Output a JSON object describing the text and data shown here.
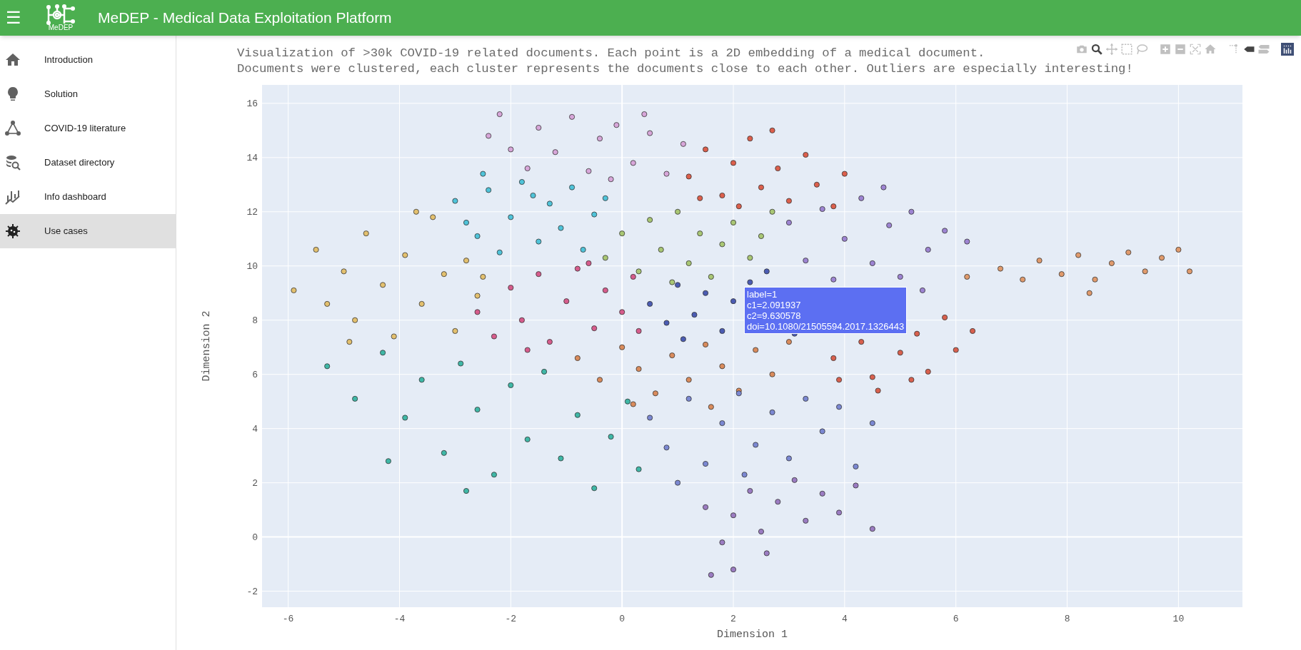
{
  "header": {
    "menu_icon": "☰",
    "logo_text": "MeDEP",
    "title": "MeDEP - Medical Data Exploitation Platform"
  },
  "sidebar": {
    "items": [
      {
        "kind": "home",
        "label": "Introduction",
        "selected": false
      },
      {
        "kind": "bulb",
        "label": "Solution",
        "selected": false
      },
      {
        "kind": "network",
        "label": "COVID-19 literature",
        "selected": false
      },
      {
        "kind": "database",
        "label": "Dataset directory",
        "selected": false
      },
      {
        "kind": "chart",
        "label": "Info dashboard",
        "selected": false
      },
      {
        "kind": "virus",
        "label": "Use cases",
        "selected": true
      }
    ]
  },
  "plot": {
    "title_lines": [
      "Visualization of >30k COVID-19 related documents. Each point is a 2D embedding of a medical document.",
      "Documents were clustered, each cluster represents the documents close to each other. Outliers are especially interesting!"
    ],
    "modebar": [
      {
        "kind": "camera",
        "selected": false
      },
      {
        "kind": "zoom",
        "selected": true
      },
      {
        "kind": "pan",
        "selected": false
      },
      {
        "kind": "box",
        "selected": false
      },
      {
        "kind": "lasso",
        "selected": false
      },
      {
        "kind": "zoomin",
        "selected": false
      },
      {
        "kind": "zoomout",
        "selected": false
      },
      {
        "kind": "autoscale",
        "selected": false
      },
      {
        "kind": "home",
        "selected": false
      },
      {
        "kind": "spikes",
        "selected": false
      },
      {
        "kind": "closest",
        "selected": true
      },
      {
        "kind": "compare",
        "selected": false
      },
      {
        "kind": "logo"
      }
    ],
    "tooltip": {
      "lines": [
        "label=1",
        "c1=2.091937",
        "c2=9.630578",
        "doi=10.1080/21505594.2017.1326443"
      ]
    },
    "chart_data": {
      "type": "scatter",
      "grid": true,
      "xlabel": "Dimension 1",
      "ylabel": "Dimension 2",
      "xlim": [
        -6.47,
        11.15
      ],
      "ylim": [
        -2.59,
        16.68
      ],
      "xticks": [
        -6,
        -4,
        -2,
        0,
        2,
        4,
        6,
        8,
        10
      ],
      "yticks": [
        -2,
        0,
        2,
        4,
        6,
        8,
        10,
        12,
        14,
        16
      ],
      "series": [
        {
          "color": "#e3c06e",
          "x": [
            -5.9,
            -5.5,
            -5,
            -4.8,
            -4.6,
            -4.3,
            -4.1,
            -3.9,
            -3.6,
            -3.4,
            -3.2,
            -3,
            -2.8,
            -2.6,
            -4.9,
            -5.3,
            -3.7,
            -2.5
          ],
          "values": [
            9.1,
            10.6,
            9.8,
            8,
            11.2,
            9.3,
            7.4,
            10.4,
            8.6,
            11.8,
            9.7,
            7.6,
            10.2,
            8.9,
            7.2,
            8.6,
            12,
            9.6
          ]
        },
        {
          "color": "#4fc3d9",
          "x": [
            -3,
            -2.6,
            -2.4,
            -2.2,
            -2,
            -1.8,
            -1.5,
            -1.3,
            -1.1,
            -0.9,
            -0.7,
            -0.5,
            -2.8,
            -1.6,
            -0.3,
            -2.5
          ],
          "values": [
            12.4,
            11.1,
            12.8,
            10.5,
            11.8,
            13.1,
            10.9,
            12.3,
            11.4,
            12.9,
            10.6,
            11.9,
            11.6,
            12.6,
            12.5,
            13.4
          ]
        },
        {
          "color": "#d7a6d9",
          "x": [
            -2.2,
            -2,
            -1.7,
            -1.5,
            -1.2,
            -0.9,
            -0.6,
            -0.4,
            -0.1,
            0.2,
            0.5,
            0.8,
            1.1,
            -0.2,
            0.4,
            -2.4
          ],
          "values": [
            15.6,
            14.3,
            13.6,
            15.1,
            14.2,
            15.5,
            13.5,
            14.7,
            15.2,
            13.8,
            14.9,
            13.4,
            14.5,
            13.2,
            15.6,
            14.8
          ]
        },
        {
          "color": "#dc5f4c",
          "x": [
            1.2,
            1.5,
            1.8,
            2,
            2.3,
            2.5,
            2.8,
            3,
            3.3,
            3.5,
            3.8,
            2.1,
            1.4,
            2.7,
            4
          ],
          "values": [
            13.3,
            14.3,
            12.6,
            13.8,
            14.7,
            12.9,
            13.6,
            12.4,
            14.1,
            13,
            12.2,
            12.2,
            12.5,
            15,
            13.4
          ]
        },
        {
          "color": "#a9c774",
          "x": [
            -0.3,
            0,
            0.3,
            0.5,
            0.7,
            1,
            1.2,
            1.4,
            1.6,
            1.8,
            2,
            2.3,
            2.5,
            0.9,
            2.7
          ],
          "values": [
            10.3,
            11.2,
            9.8,
            11.7,
            10.6,
            12,
            10.1,
            11.2,
            9.6,
            10.8,
            11.6,
            10.3,
            11.1,
            9.4,
            12
          ]
        },
        {
          "color": "#9d84d2",
          "x": [
            3,
            3.3,
            3.6,
            3.8,
            4,
            4.3,
            4.5,
            4.8,
            5,
            5.2,
            5.5,
            5.8,
            6.2,
            4.7,
            5.4
          ],
          "values": [
            11.6,
            10.2,
            12.1,
            9.5,
            11,
            12.5,
            10.1,
            11.5,
            9.6,
            12,
            10.6,
            11.3,
            10.9,
            12.9,
            9.1
          ]
        },
        {
          "color": "#d65c8c",
          "x": [
            -2.6,
            -2.3,
            -2,
            -1.8,
            -1.5,
            -1.3,
            -1,
            -0.8,
            -0.5,
            -0.3,
            0,
            0.2,
            -1.7,
            -0.6,
            0.3
          ],
          "values": [
            8.3,
            7.4,
            9.2,
            8,
            9.7,
            7.2,
            8.7,
            9.9,
            7.7,
            9.1,
            8.3,
            9.6,
            6.9,
            10.1,
            7.6
          ]
        },
        {
          "color": "#4b5cb3",
          "x": [
            0.5,
            0.8,
            1,
            1.3,
            1.5,
            1.8,
            2,
            2.3,
            3.1,
            1.1,
            2.6
          ],
          "values": [
            8.6,
            7.9,
            9.3,
            8.2,
            9,
            7.6,
            8.7,
            9.4,
            7.5,
            7.3,
            9.8
          ]
        },
        {
          "color": "#d8604e",
          "x": [
            3.8,
            4.3,
            4.5,
            5,
            5.3,
            5.5,
            5.8,
            6,
            6.3,
            4.6,
            5.2,
            3.9
          ],
          "values": [
            6.6,
            7.2,
            5.9,
            6.8,
            7.5,
            6.1,
            8.1,
            6.9,
            7.6,
            5.4,
            5.8,
            5.8
          ]
        },
        {
          "color": "#d98b5c",
          "x": [
            -0.8,
            -0.4,
            0,
            0.3,
            0.6,
            0.9,
            1.2,
            1.5,
            1.8,
            2.1,
            2.4,
            2.7,
            3,
            0.2,
            1.6
          ],
          "values": [
            6.6,
            5.8,
            7,
            6.2,
            5.3,
            6.7,
            5.8,
            7.1,
            6.3,
            5.4,
            6.9,
            6,
            7.2,
            4.9,
            4.8
          ]
        },
        {
          "color": "#3fb7a6",
          "x": [
            -5.3,
            -4.8,
            -4.3,
            -3.9,
            -3.6,
            -3.2,
            -2.9,
            -2.6,
            -2.3,
            -2,
            -1.7,
            -1.4,
            -1.1,
            -0.8,
            -0.5,
            -0.2,
            0.1,
            0.3,
            -2.8,
            -4.2
          ],
          "values": [
            6.3,
            5.1,
            6.8,
            4.4,
            5.8,
            3.1,
            6.4,
            4.7,
            2.3,
            5.6,
            3.6,
            6.1,
            2.9,
            4.5,
            1.8,
            3.7,
            5,
            2.5,
            1.7,
            2.8
          ]
        },
        {
          "color": "#7b88d2",
          "x": [
            0.5,
            0.8,
            1.2,
            1.5,
            1.8,
            2.1,
            2.4,
            2.7,
            3,
            3.3,
            3.6,
            3.9,
            4.2,
            4.5,
            1,
            2.2
          ],
          "values": [
            4.4,
            3.3,
            5.1,
            2.7,
            4.2,
            5.3,
            3.4,
            4.6,
            2.9,
            5.1,
            3.9,
            4.8,
            2.6,
            4.2,
            2,
            2.3
          ]
        },
        {
          "color": "#9b7cc2",
          "x": [
            1.5,
            1.8,
            2,
            2,
            2.3,
            2.5,
            2.8,
            3.1,
            3.3,
            3.6,
            3.9,
            4.2,
            4.5,
            1.6,
            2.6
          ],
          "values": [
            1.1,
            -0.2,
            0.8,
            -1.2,
            1.7,
            0.2,
            1.3,
            2.1,
            0.6,
            1.6,
            0.9,
            1.9,
            0.3,
            -1.4,
            -0.6
          ]
        },
        {
          "color": "#e09a6c",
          "x": [
            6.2,
            6.8,
            7.2,
            7.5,
            7.9,
            8.2,
            8.5,
            8.8,
            9.1,
            9.4,
            9.7,
            10,
            10.2,
            8.4
          ],
          "values": [
            9.6,
            9.9,
            9.5,
            10.2,
            9.7,
            10.4,
            9.5,
            10.1,
            10.5,
            9.8,
            10.3,
            10.6,
            9.8,
            9
          ]
        }
      ]
    }
  }
}
